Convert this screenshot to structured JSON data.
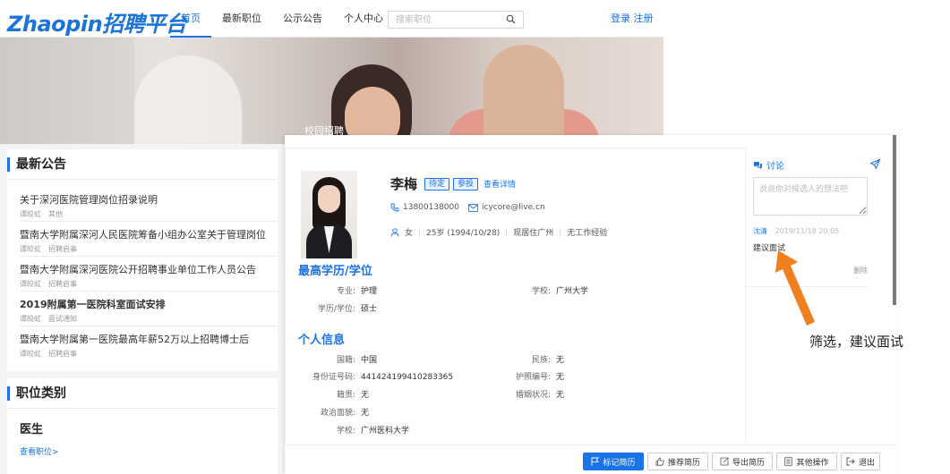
{
  "brand": {
    "logo_text": "Zhaopin招聘平台",
    "accent": "#1a73e8"
  },
  "nav": {
    "items": [
      {
        "label": "首页",
        "active": true
      },
      {
        "label": "最新职位",
        "active": false
      },
      {
        "label": "公示公告",
        "active": false
      },
      {
        "label": "个人中心",
        "active": false
      }
    ],
    "search_placeholder": "搜索职位",
    "login_label": "登录",
    "register_label": "注册"
  },
  "banner": {
    "caption": "校园招聘"
  },
  "announcements": {
    "title": "最新公告",
    "items": [
      {
        "title": "关于深河医院管理岗位招录说明",
        "author": "谭皎虹",
        "category": "其他"
      },
      {
        "title": "暨南大学附属深河人民医院筹备小组办公室关于管理岗位",
        "author": "谭皎虹",
        "category": "招聘启事"
      },
      {
        "title": "暨南大学附属深河医院公开招聘事业单位工作人员公告",
        "author": "谭皎虹",
        "category": "招聘启事"
      },
      {
        "title": "2019附属第一医院科室面试安排",
        "author": "谭皎虹",
        "category": "面试通知"
      },
      {
        "title": "暨南大学附属第一医院最高年薪52万以上招聘博士后",
        "author": "谭皎虹",
        "category": "招聘启事"
      }
    ]
  },
  "job_categories": {
    "title": "职位类别",
    "category_name": "医生",
    "view_link": "查看职位>"
  },
  "candidate": {
    "name": "李梅",
    "status_tag": "待定",
    "apply_tag": "参投",
    "detail_link": "查看详情",
    "phone": "13800138000",
    "email": "icycore@live.cn",
    "gender": "女",
    "age": "25岁 (1994/10/28)",
    "location": "现居住广州",
    "experience": "无工作经验"
  },
  "education": {
    "title": "最高学历/学位",
    "major_label": "专业:",
    "major": "护理",
    "school_label": "学校:",
    "school": "广州大学",
    "degree_label": "学历/学位:",
    "degree": "硕士"
  },
  "personal": {
    "title": "个人信息",
    "fields": {
      "nationality": {
        "label": "国籍:",
        "value": "中国"
      },
      "ethnicity": {
        "label": "民族:",
        "value": "无"
      },
      "id_number": {
        "label": "身份证号码:",
        "value": "441424199410283365"
      },
      "nurse_license": {
        "label": "护照编号:",
        "value": "无"
      },
      "native_place": {
        "label": "籍贯:",
        "value": "无"
      },
      "marital": {
        "label": "婚姻状况:",
        "value": "无"
      },
      "political": {
        "label": "政治面貌:",
        "value": "无"
      },
      "school": {
        "label": "学校:",
        "value": "广州医科大学"
      }
    }
  },
  "discussion": {
    "title": "讨论",
    "input_placeholder": "说说你对候选人的想法吧",
    "comment": {
      "author": "沈清",
      "time": "2019/11/18 20:05",
      "text": "建议面试"
    },
    "delete_label": "删除"
  },
  "actions": {
    "mark": "标记简历",
    "recommend": "推荐简历",
    "export": "导出简历",
    "other": "其他操作",
    "exit": "退出"
  },
  "annotation": {
    "text": "筛选，建议面试",
    "color": "#f07f1e"
  }
}
